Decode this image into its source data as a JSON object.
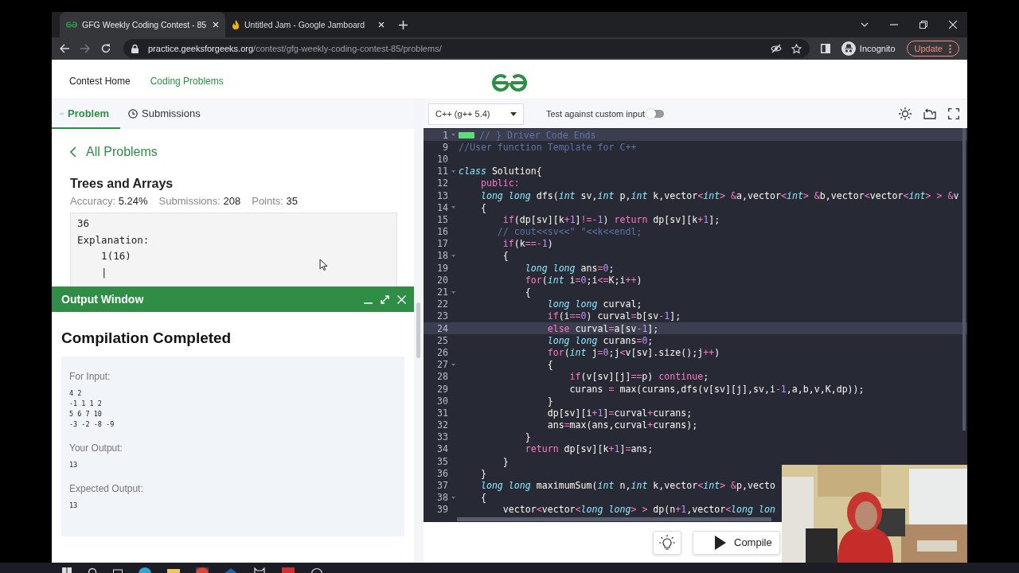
{
  "browser": {
    "tabs": [
      {
        "title": "GFG Weekly Coding Contest - 85",
        "selected": true
      },
      {
        "title": "Untitled Jam - Google Jamboard",
        "selected": false
      }
    ],
    "url_host": "practice.geeksforgeeks.org",
    "url_path": "/contest/gfg-weekly-coding-contest-85/problems/",
    "profile": "Incognito",
    "update_button": "Update"
  },
  "header": {
    "nav": [
      {
        "label": "Contest Home",
        "selected": false
      },
      {
        "label": "Coding Problems",
        "selected": true
      }
    ]
  },
  "problem_tabs": [
    {
      "label": "Problem",
      "selected": true
    },
    {
      "label": "Submissions",
      "selected": false
    }
  ],
  "back_link": "All Problems",
  "problem": {
    "title": "Trees and Arrays",
    "stats": [
      {
        "label": "Accuracy:",
        "value": "5.24%"
      },
      {
        "label": "Submissions:",
        "value": "208"
      },
      {
        "label": "Points:",
        "value": "35"
      }
    ],
    "example_lines": [
      "36",
      "Explanation:",
      "    1(16)",
      "    |"
    ]
  },
  "output_window": {
    "title": "Output Window",
    "heading": "Compilation Completed",
    "sections": [
      {
        "label": "For Input:",
        "lines": [
          "4 2",
          "-1 1 1 2",
          "5 6 7 10",
          "-3 -2 -8 -9"
        ]
      },
      {
        "label": "Your Output:",
        "lines": [
          "13"
        ]
      },
      {
        "label": "Expected Output:",
        "lines": [
          "13"
        ]
      }
    ]
  },
  "editor": {
    "language": "C++ (g++ 5.4)",
    "custom_input": {
      "label": "Test against custom input",
      "on": false
    },
    "lines": [
      {
        "number": "1",
        "highlighted": true,
        "foldable": true,
        "folded": true,
        "tokens": [
          {
            "kind": "com",
            "text": "// } Driver Code Ends"
          }
        ]
      },
      {
        "number": "9",
        "highlighted": false,
        "foldable": false,
        "folded": false,
        "tokens": [
          {
            "kind": "com",
            "text": "//User function Template for C++"
          }
        ]
      },
      {
        "number": "10",
        "highlighted": false,
        "foldable": false,
        "folded": false
      },
      {
        "number": "11",
        "highlighted": false,
        "foldable": true,
        "folded": false,
        "tokens": [
          {
            "kind": "type",
            "text": "class"
          },
          {
            "kind": "txt",
            "text": " Solution{"
          }
        ]
      },
      {
        "number": "12",
        "highlighted": false,
        "foldable": false,
        "folded": false,
        "tokens": [
          {
            "kind": "key",
            "text": "    public:"
          }
        ]
      },
      {
        "number": "13",
        "highlighted": false,
        "foldable": false,
        "folded": false,
        "tokens": [
          {
            "kind": "type",
            "text": "    long long"
          },
          {
            "kind": "txt",
            "text": " dfs("
          },
          {
            "kind": "type",
            "text": "int"
          },
          {
            "kind": "txt",
            "text": " sv,"
          },
          {
            "kind": "type",
            "text": "int"
          },
          {
            "kind": "txt",
            "text": " p,"
          },
          {
            "kind": "type",
            "text": "int"
          },
          {
            "kind": "txt",
            "text": " k,vector"
          },
          {
            "kind": "op",
            "text": "<"
          },
          {
            "kind": "type",
            "text": "int"
          },
          {
            "kind": "op",
            "text": "> &"
          },
          {
            "kind": "txt",
            "text": "a,vector"
          },
          {
            "kind": "op",
            "text": "<"
          },
          {
            "kind": "type",
            "text": "int"
          },
          {
            "kind": "op",
            "text": "> &"
          },
          {
            "kind": "txt",
            "text": "b,vector"
          },
          {
            "kind": "op",
            "text": "<"
          },
          {
            "kind": "txt",
            "text": "vector"
          },
          {
            "kind": "op",
            "text": "<"
          },
          {
            "kind": "type",
            "text": "int"
          },
          {
            "kind": "op",
            "text": "> > &"
          },
          {
            "kind": "txt",
            "text": "v"
          }
        ]
      },
      {
        "number": "14",
        "highlighted": false,
        "foldable": true,
        "folded": false,
        "tokens": [
          {
            "kind": "txt",
            "text": "    {"
          }
        ]
      },
      {
        "number": "15",
        "highlighted": false,
        "foldable": false,
        "folded": false,
        "tokens": [
          {
            "kind": "key",
            "text": "        if"
          },
          {
            "kind": "txt",
            "text": "(dp[sv][k"
          },
          {
            "kind": "op",
            "text": "+"
          },
          {
            "kind": "num",
            "text": "1"
          },
          {
            "kind": "txt",
            "text": "]"
          },
          {
            "kind": "op",
            "text": "!=-"
          },
          {
            "kind": "num",
            "text": "1"
          },
          {
            "kind": "txt",
            "text": ") "
          },
          {
            "kind": "key",
            "text": "return"
          },
          {
            "kind": "txt",
            "text": " dp[sv][k"
          },
          {
            "kind": "op",
            "text": "+"
          },
          {
            "kind": "num",
            "text": "1"
          },
          {
            "kind": "txt",
            "text": "];"
          }
        ]
      },
      {
        "number": "16",
        "highlighted": false,
        "foldable": false,
        "folded": false,
        "tokens": [
          {
            "kind": "com",
            "text": "       // cout<<sv<<\" \"<<k<<endl;"
          }
        ]
      },
      {
        "number": "17",
        "highlighted": false,
        "foldable": false,
        "folded": false,
        "tokens": [
          {
            "kind": "key",
            "text": "        if"
          },
          {
            "kind": "txt",
            "text": "(k"
          },
          {
            "kind": "op",
            "text": "==-"
          },
          {
            "kind": "num",
            "text": "1"
          },
          {
            "kind": "txt",
            "text": ")"
          }
        ]
      },
      {
        "number": "18",
        "highlighted": false,
        "foldable": true,
        "folded": false,
        "tokens": [
          {
            "kind": "txt",
            "text": "        {"
          }
        ]
      },
      {
        "number": "19",
        "highlighted": false,
        "foldable": false,
        "folded": false,
        "tokens": [
          {
            "kind": "type",
            "text": "            long long"
          },
          {
            "kind": "txt",
            "text": " ans"
          },
          {
            "kind": "op",
            "text": "="
          },
          {
            "kind": "num",
            "text": "0"
          },
          {
            "kind": "txt",
            "text": ";"
          }
        ]
      },
      {
        "number": "20",
        "highlighted": false,
        "foldable": false,
        "folded": false,
        "tokens": [
          {
            "kind": "key",
            "text": "            for"
          },
          {
            "kind": "txt",
            "text": "("
          },
          {
            "kind": "type",
            "text": "int"
          },
          {
            "kind": "txt",
            "text": " i"
          },
          {
            "kind": "op",
            "text": "="
          },
          {
            "kind": "num",
            "text": "0"
          },
          {
            "kind": "txt",
            "text": ";i"
          },
          {
            "kind": "op",
            "text": "<="
          },
          {
            "kind": "txt",
            "text": "K;i"
          },
          {
            "kind": "op",
            "text": "++"
          },
          {
            "kind": "txt",
            "text": ")"
          }
        ]
      },
      {
        "number": "21",
        "highlighted": false,
        "foldable": true,
        "folded": false,
        "tokens": [
          {
            "kind": "txt",
            "text": "            {"
          }
        ]
      },
      {
        "number": "22",
        "highlighted": false,
        "foldable": false,
        "folded": false,
        "tokens": [
          {
            "kind": "type",
            "text": "                long long"
          },
          {
            "kind": "txt",
            "text": " curval;"
          }
        ]
      },
      {
        "number": "23",
        "highlighted": false,
        "foldable": false,
        "folded": false,
        "tokens": [
          {
            "kind": "key",
            "text": "                if"
          },
          {
            "kind": "txt",
            "text": "(i"
          },
          {
            "kind": "op",
            "text": "=="
          },
          {
            "kind": "num",
            "text": "0"
          },
          {
            "kind": "txt",
            "text": ") curval"
          },
          {
            "kind": "op",
            "text": "="
          },
          {
            "kind": "txt",
            "text": "b[sv"
          },
          {
            "kind": "op",
            "text": "-"
          },
          {
            "kind": "num",
            "text": "1"
          },
          {
            "kind": "txt",
            "text": "];"
          }
        ]
      },
      {
        "number": "24",
        "highlighted": true,
        "foldable": false,
        "folded": false,
        "tokens": [
          {
            "kind": "key",
            "text": "                else"
          },
          {
            "kind": "txt",
            "text": " curval"
          },
          {
            "kind": "op",
            "text": "="
          },
          {
            "kind": "txt",
            "text": "a[sv"
          },
          {
            "kind": "op",
            "text": "-"
          },
          {
            "kind": "num",
            "text": "1"
          },
          {
            "kind": "txt",
            "text": "];"
          }
        ]
      },
      {
        "number": "25",
        "highlighted": false,
        "foldable": false,
        "folded": false,
        "tokens": [
          {
            "kind": "type",
            "text": "                long long"
          },
          {
            "kind": "txt",
            "text": " curans"
          },
          {
            "kind": "op",
            "text": "="
          },
          {
            "kind": "num",
            "text": "0"
          },
          {
            "kind": "txt",
            "text": ";"
          }
        ]
      },
      {
        "number": "26",
        "highlighted": false,
        "foldable": false,
        "folded": false,
        "tokens": [
          {
            "kind": "key",
            "text": "                for"
          },
          {
            "kind": "txt",
            "text": "("
          },
          {
            "kind": "type",
            "text": "int"
          },
          {
            "kind": "txt",
            "text": " j"
          },
          {
            "kind": "op",
            "text": "="
          },
          {
            "kind": "num",
            "text": "0"
          },
          {
            "kind": "txt",
            "text": ";j"
          },
          {
            "kind": "op",
            "text": "<"
          },
          {
            "kind": "txt",
            "text": "v[sv].size();j"
          },
          {
            "kind": "op",
            "text": "++"
          },
          {
            "kind": "txt",
            "text": ")"
          }
        ]
      },
      {
        "number": "27",
        "highlighted": false,
        "foldable": true,
        "folded": false,
        "tokens": [
          {
            "kind": "txt",
            "text": "                {"
          }
        ]
      },
      {
        "number": "28",
        "highlighted": false,
        "foldable": false,
        "folded": false,
        "tokens": [
          {
            "kind": "key",
            "text": "                    if"
          },
          {
            "kind": "txt",
            "text": "(v[sv][j]"
          },
          {
            "kind": "op",
            "text": "=="
          },
          {
            "kind": "txt",
            "text": "p) "
          },
          {
            "kind": "key",
            "text": "continue"
          },
          {
            "kind": "txt",
            "text": ";"
          }
        ]
      },
      {
        "number": "29",
        "highlighted": false,
        "foldable": false,
        "folded": false,
        "tokens": [
          {
            "kind": "txt",
            "text": "                    curans "
          },
          {
            "kind": "op",
            "text": "="
          },
          {
            "kind": "txt",
            "text": " max(curans,dfs(v[sv][j],sv,i"
          },
          {
            "kind": "op",
            "text": "-"
          },
          {
            "kind": "num",
            "text": "1"
          },
          {
            "kind": "txt",
            "text": ",a,b,v,K,dp));"
          }
        ]
      },
      {
        "number": "30",
        "highlighted": false,
        "foldable": false,
        "folded": false,
        "tokens": [
          {
            "kind": "txt",
            "text": "                }"
          }
        ]
      },
      {
        "number": "31",
        "highlighted": false,
        "foldable": false,
        "folded": false,
        "tokens": [
          {
            "kind": "txt",
            "text": "                dp[sv][i"
          },
          {
            "kind": "op",
            "text": "+"
          },
          {
            "kind": "num",
            "text": "1"
          },
          {
            "kind": "txt",
            "text": "]"
          },
          {
            "kind": "op",
            "text": "="
          },
          {
            "kind": "txt",
            "text": "curval"
          },
          {
            "kind": "op",
            "text": "+"
          },
          {
            "kind": "txt",
            "text": "curans;"
          }
        ]
      },
      {
        "number": "32",
        "highlighted": false,
        "foldable": false,
        "folded": false,
        "tokens": [
          {
            "kind": "txt",
            "text": "                ans"
          },
          {
            "kind": "op",
            "text": "="
          },
          {
            "kind": "txt",
            "text": "max(ans,curval"
          },
          {
            "kind": "op",
            "text": "+"
          },
          {
            "kind": "txt",
            "text": "curans);"
          }
        ]
      },
      {
        "number": "33",
        "highlighted": false,
        "foldable": false,
        "folded": false,
        "tokens": [
          {
            "kind": "txt",
            "text": "            }"
          }
        ]
      },
      {
        "number": "34",
        "highlighted": false,
        "foldable": false,
        "folded": false,
        "tokens": [
          {
            "kind": "key",
            "text": "            return"
          },
          {
            "kind": "txt",
            "text": " dp[sv][k"
          },
          {
            "kind": "op",
            "text": "+"
          },
          {
            "kind": "num",
            "text": "1"
          },
          {
            "kind": "txt",
            "text": "]"
          },
          {
            "kind": "op",
            "text": "="
          },
          {
            "kind": "txt",
            "text": "ans;"
          }
        ]
      },
      {
        "number": "35",
        "highlighted": false,
        "foldable": false,
        "folded": false,
        "tokens": [
          {
            "kind": "txt",
            "text": "        }"
          }
        ]
      },
      {
        "number": "36",
        "highlighted": false,
        "foldable": false,
        "folded": false,
        "tokens": [
          {
            "kind": "txt",
            "text": "    }"
          }
        ]
      },
      {
        "number": "37",
        "highlighted": false,
        "foldable": false,
        "folded": false,
        "tokens": [
          {
            "kind": "type",
            "text": "    long long"
          },
          {
            "kind": "txt",
            "text": " maximumSum("
          },
          {
            "kind": "type",
            "text": "int"
          },
          {
            "kind": "txt",
            "text": " n,"
          },
          {
            "kind": "type",
            "text": "int"
          },
          {
            "kind": "txt",
            "text": " k,vector"
          },
          {
            "kind": "op",
            "text": "<"
          },
          {
            "kind": "type",
            "text": "int"
          },
          {
            "kind": "op",
            "text": "> &"
          },
          {
            "kind": "txt",
            "text": "p,vecto"
          }
        ]
      },
      {
        "number": "38",
        "highlighted": false,
        "foldable": true,
        "folded": false,
        "tokens": [
          {
            "kind": "txt",
            "text": "    {"
          }
        ]
      },
      {
        "number": "39",
        "highlighted": false,
        "foldable": false,
        "folded": false,
        "tokens": [
          {
            "kind": "txt",
            "text": "        vector"
          },
          {
            "kind": "op",
            "text": "<"
          },
          {
            "kind": "txt",
            "text": "vector"
          },
          {
            "kind": "op",
            "text": "<"
          },
          {
            "kind": "type",
            "text": "long long"
          },
          {
            "kind": "op",
            "text": "> >"
          },
          {
            "kind": "txt",
            "text": " dp(n"
          },
          {
            "kind": "op",
            "text": "+"
          },
          {
            "kind": "num",
            "text": "1"
          },
          {
            "kind": "txt",
            "text": ",vector"
          },
          {
            "kind": "op",
            "text": "<"
          },
          {
            "kind": "type",
            "text": "long lon"
          }
        ]
      }
    ]
  },
  "actions": {
    "compile_button": "Compile"
  }
}
